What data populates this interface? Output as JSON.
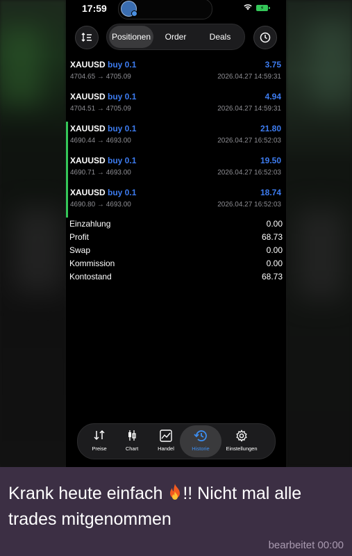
{
  "status_bar": {
    "time": "17:59",
    "battery": "⚡"
  },
  "toolbar": {
    "tabs": [
      {
        "label": "Positionen",
        "active": true
      },
      {
        "label": "Order",
        "active": false
      },
      {
        "label": "Deals",
        "active": false
      }
    ]
  },
  "deals": [
    {
      "symbol": "XAUUSD",
      "direction": "buy 0.1",
      "profit": "3.75",
      "prices": "4704.65 → 4705.09",
      "date": "2026.04.27 14:59:31"
    },
    {
      "symbol": "XAUUSD",
      "direction": "buy 0.1",
      "profit": "4.94",
      "prices": "4704.51 → 4705.09",
      "date": "2026.04.27 14:59:31"
    },
    {
      "symbol": "XAUUSD",
      "direction": "buy 0.1",
      "profit": "21.80",
      "prices": "4690.44 → 4693.00",
      "date": "2026.04.27 16:52:03"
    },
    {
      "symbol": "XAUUSD",
      "direction": "buy 0.1",
      "profit": "19.50",
      "prices": "4690.71 → 4693.00",
      "date": "2026.04.27 16:52:03"
    },
    {
      "symbol": "XAUUSD",
      "direction": "buy 0.1",
      "profit": "18.74",
      "prices": "4690.80 → 4693.00",
      "date": "2026.04.27 16:52:03"
    }
  ],
  "summary": [
    {
      "label": "Einzahlung",
      "value": "0.00"
    },
    {
      "label": "Profit",
      "value": "68.73"
    },
    {
      "label": "Swap",
      "value": "0.00"
    },
    {
      "label": "Kommission",
      "value": "0.00"
    },
    {
      "label": "Kontostand",
      "value": "68.73"
    }
  ],
  "nav": [
    {
      "label": "Preise",
      "icon": "prices-icon",
      "active": false
    },
    {
      "label": "Chart",
      "icon": "chart-icon",
      "active": false
    },
    {
      "label": "Handel",
      "icon": "trade-icon",
      "active": false
    },
    {
      "label": "Historie",
      "icon": "history-icon",
      "active": true
    },
    {
      "label": "Einstellungen",
      "icon": "gear-icon",
      "active": false
    }
  ],
  "message": {
    "text_before": "Krank heute einfach ",
    "text_after": "!! Nicht mal alle trades mitgenommen",
    "emoji_icon": "fire-icon",
    "edited": "bearbeitet 00:00"
  },
  "colors": {
    "accent_blue": "#3d7cf0",
    "profit_bar": "#34c759",
    "message_bg": "#3c2f44"
  }
}
